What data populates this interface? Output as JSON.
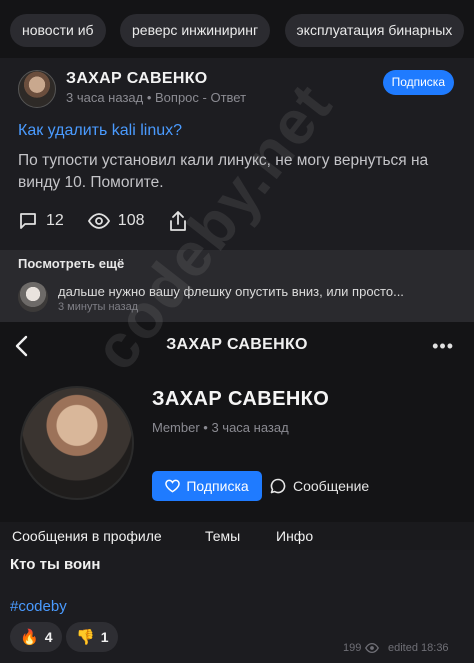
{
  "tags": [
    "новости иб",
    "реверс инжиниринг",
    "эксплуатация бинарных"
  ],
  "post": {
    "author": "ЗАХАР САВЕНКО",
    "meta": "3 часа назад • Вопрос - Ответ",
    "subscribe_label": "Подписка",
    "title": "Как удалить kali linux?",
    "body": "По тупости установил кали линукс, не могу вернуться на винду 10. Помогите.",
    "comments_count": "12",
    "views_count": "108"
  },
  "see_more": {
    "title": "Посмотреть ещё",
    "comment_text": "дальше нужно вашу флешку опустить вниз, или просто...",
    "comment_time": "3 минуты назад"
  },
  "profile": {
    "header_title": "ЗАХАР САВЕНКО",
    "name": "ЗАХАР САВЕНКО",
    "meta": "Member • 3 часа назад",
    "subscribe_label": "Подписка",
    "message_label": "Сообщение",
    "tabs": [
      "Сообщения в профиле",
      "Темы",
      "Инфо"
    ],
    "message_title": "Кто ты воин",
    "hashtag": "#codeby",
    "reactions": [
      {
        "icon": "fire-icon",
        "count": "4"
      },
      {
        "icon": "dislike-icon",
        "count": "1"
      }
    ],
    "views": "199",
    "edited": "edited 18:36"
  },
  "watermark": "codeby.net",
  "colors": {
    "accent": "#1f7bff",
    "link": "#4a9bff"
  }
}
